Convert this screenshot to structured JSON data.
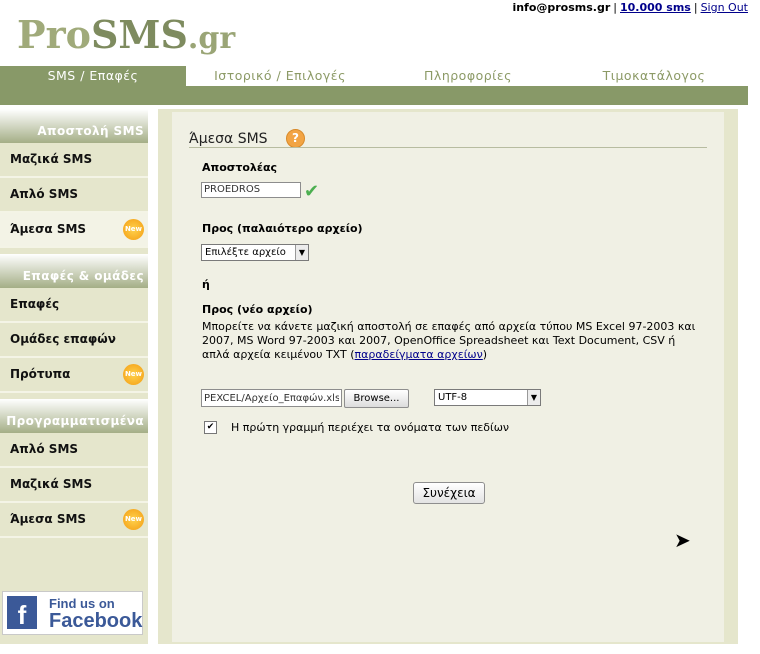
{
  "header": {
    "logo_pro": "Pro",
    "logo_sms": "SMS",
    "logo_gr": ".gr",
    "email": "info@prosms.gr",
    "credits": "10.000 sms",
    "signout": "Sign Out"
  },
  "nav": {
    "tabs": [
      {
        "label": "SMS / Επαφές",
        "active": true
      },
      {
        "label": "Ιστορικό / Επιλογές",
        "active": false
      },
      {
        "label": "Πληροφορίες",
        "active": false
      },
      {
        "label": "Τιμοκατάλογος",
        "active": false
      }
    ]
  },
  "sidebar": {
    "section1": "Αποστολή SMS",
    "s1_items": [
      "Μαζικά SMS",
      "Απλό SMS",
      "Άμεσα SMS"
    ],
    "section2": "Επαφές & ομάδες",
    "s2_items": [
      "Επαφές",
      "Ομάδες επαφών",
      "Πρότυπα"
    ],
    "section3": "Προγραμματισμένα",
    "s3_items": [
      "Απλό SMS",
      "Μαζικά SMS",
      "Άμεσα SMS"
    ],
    "new_badge": "New",
    "facebook_findus": "Find us on",
    "facebook_name": "Facebook",
    "facebook_letter": "f"
  },
  "main": {
    "title": "Άμεσα SMS",
    "help": "?",
    "sender_label": "Αποστολέας",
    "sender_value": "PROEDROS",
    "to_old_label": "Προς (παλαιότερο αρχείο)",
    "to_old_select": "Επιλέξτε αρχείο",
    "or": "ή",
    "to_new_label": "Προς (νέο αρχείο)",
    "desc_text": "Μπορείτε να κάνετε μαζική αποστολή σε επαφές από αρχεία τύπου MS Excel 97-2003 και 2007, MS Word 97-2003 και 2007, OpenOffice Spreadsheet και Text Document, CSV ή απλά αρχεία κειμένου TXT (",
    "desc_link": "παραδείγματα αρχείων",
    "desc_end": ")",
    "file_value": "PEXCEL/Αρχείο_Επαφών.xls",
    "browse": "Browse...",
    "encoding": "UTF-8",
    "checkbox_label": "Η πρώτη γραμμή περιέχει τα ονόματα των πεδίων",
    "checkbox_mark": "✔",
    "continue": "Συνέχεια"
  }
}
